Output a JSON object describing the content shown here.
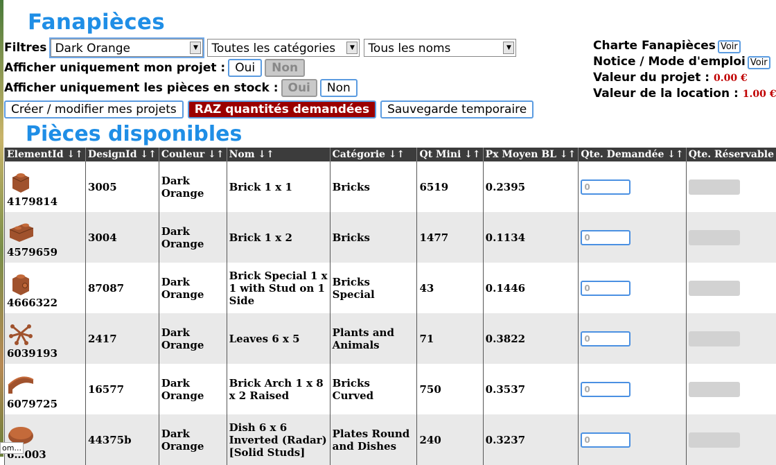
{
  "site": {
    "title": "Fanapièces"
  },
  "filters": {
    "label": "Filtres",
    "color": "Dark Orange",
    "category": "Toutes les catégories",
    "name": "Tous les noms"
  },
  "project_only": {
    "label": "Afficher uniquement mon projet :",
    "yes": "Oui",
    "no": "Non"
  },
  "stock_only": {
    "label": "Afficher uniquement les pièces en stock :",
    "yes": "Oui",
    "no": "Non"
  },
  "actions": {
    "projects": "Créer / modifier mes projets",
    "reset": "RAZ quantités demandées",
    "save": "Sauvegarde temporaire"
  },
  "info": {
    "charter": "Charte Fanapièces",
    "manual": "Notice / Mode d'emploi",
    "view": "Voir",
    "project_value_label": "Valeur du projet :",
    "project_value": "0.00 €",
    "rental_value_label": "Valeur de la location :",
    "rental_value": "1.00 €"
  },
  "section_title": "Pièces disponibles",
  "table": {
    "headers": [
      "ElementId ↓↑",
      "DesignId ↓↑",
      "Couleur ↓↑",
      "Nom ↓↑",
      "Catégorie ↓↑",
      "Qt Mini ↓↑",
      "Px Moyen BL ↓↑",
      "Qte. Demandée ↓↑",
      "Qte. Réservable"
    ],
    "qty_placeholder": "0",
    "rows": [
      {
        "element_id": "4179814",
        "design_id": "3005",
        "color": "Dark Orange",
        "name": "Brick 1 x 1",
        "category": "Bricks",
        "qt_min": "6519",
        "price": "0.2395",
        "icon": "brick-1x1-icon"
      },
      {
        "element_id": "4579659",
        "design_id": "3004",
        "color": "Dark Orange",
        "name": "Brick 1 x 2",
        "category": "Bricks",
        "qt_min": "1477",
        "price": "0.1134",
        "icon": "brick-1x2-icon"
      },
      {
        "element_id": "4666322",
        "design_id": "87087",
        "color": "Dark Orange",
        "name": "Brick Special 1 x 1 with Stud on 1 Side",
        "category": "Bricks Special",
        "qt_min": "43",
        "price": "0.1446",
        "icon": "brick-special-icon"
      },
      {
        "element_id": "6039193",
        "design_id": "2417",
        "color": "Dark Orange",
        "name": "Leaves 6 x 5",
        "category": "Plants and Animals",
        "qt_min": "71",
        "price": "0.3822",
        "icon": "leaves-icon"
      },
      {
        "element_id": "6079725",
        "design_id": "16577",
        "color": "Dark Orange",
        "name": "Brick Arch 1 x 8 x 2 Raised",
        "category": "Bricks Curved",
        "qt_min": "750",
        "price": "0.3537",
        "icon": "arch-icon"
      },
      {
        "element_id": "6…003",
        "design_id": "44375b",
        "color": "Dark Orange",
        "name": "Dish 6 x 6 Inverted (Radar) [Solid Studs]",
        "category": "Plates Round and Dishes",
        "qt_min": "240",
        "price": "0.3237",
        "icon": "dish-icon"
      }
    ]
  },
  "tooltip": "om...",
  "colors": {
    "title_blue": "#1f8ee6",
    "accent_red": "#9b0000",
    "piece": "#a0522d"
  }
}
